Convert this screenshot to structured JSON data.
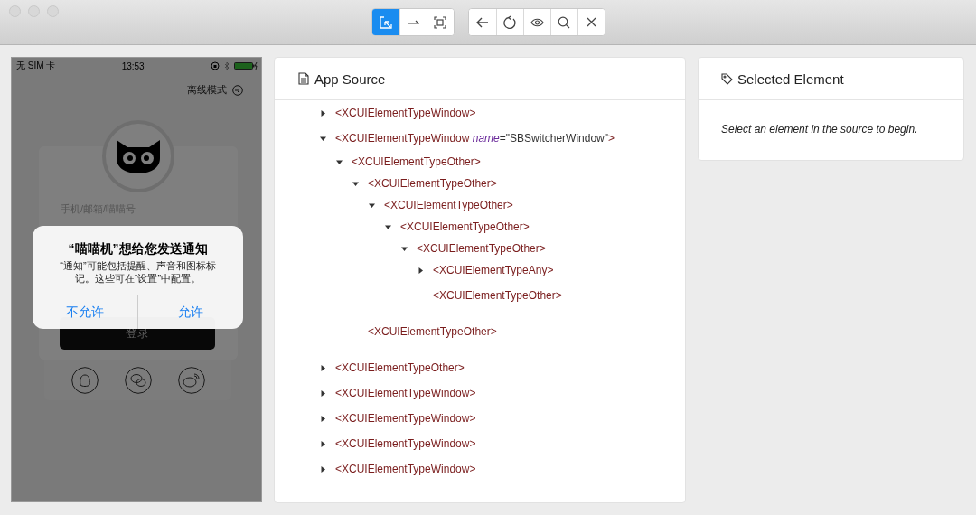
{
  "toolbar": {
    "groups": [
      {
        "buttons": [
          {
            "kind": "select",
            "selected": true
          },
          {
            "kind": "swipe",
            "selected": false
          },
          {
            "kind": "tap-area",
            "selected": false
          }
        ]
      },
      {
        "buttons": [
          {
            "kind": "back",
            "selected": false
          },
          {
            "kind": "refresh",
            "selected": false
          },
          {
            "kind": "eye",
            "selected": false
          },
          {
            "kind": "search",
            "selected": false
          },
          {
            "kind": "close",
            "selected": false
          }
        ]
      }
    ]
  },
  "phone": {
    "status_bar": {
      "carrier": "无 SIM 卡",
      "time": "13:53"
    },
    "offline_link": "离线模式",
    "login_field": {
      "placeholder": "手机/邮箱/喵喵号"
    },
    "login_button": "登录",
    "alert": {
      "title": "“喵喵机”想给您发送通知",
      "message": "“通知”可能包括提醒、声音和图标标记。这些可在“设置”中配置。",
      "buttons": [
        "不允许",
        "允许"
      ]
    }
  },
  "source": {
    "title": "App Source",
    "tree": [
      {
        "tag": "<XCUIElementTypeWindow>",
        "expanded": false
      },
      {
        "tag": "<XCUIElementTypeWindow",
        "attr_name": "name",
        "attr_eq": "=",
        "attr_value": "\"SBSwitcherWindow\"",
        "close": ">",
        "expanded": true,
        "children": [
          {
            "tag": "<XCUIElementTypeOther>",
            "expanded": true,
            "children": [
              {
                "tag": "<XCUIElementTypeOther>",
                "expanded": true,
                "children": [
                  {
                    "tag": "<XCUIElementTypeOther>",
                    "expanded": true,
                    "children": [
                      {
                        "tag": "<XCUIElementTypeOther>",
                        "expanded": true,
                        "children": [
                          {
                            "tag": "<XCUIElementTypeOther>",
                            "expanded": true,
                            "children": [
                              {
                                "tag": "<XCUIElementTypeAny>",
                                "expanded": false
                              },
                              {
                                "tag": "<XCUIElementTypeOther>"
                              }
                            ]
                          }
                        ]
                      }
                    ]
                  }
                ]
              },
              {
                "tag": "<XCUIElementTypeOther>"
              }
            ]
          }
        ]
      },
      {
        "tag": "<XCUIElementTypeOther>",
        "expanded": false
      },
      {
        "tag": "<XCUIElementTypeWindow>",
        "expanded": false
      },
      {
        "tag": "<XCUIElementTypeWindow>",
        "expanded": false
      },
      {
        "tag": "<XCUIElementTypeWindow>",
        "expanded": false
      },
      {
        "tag": "<XCUIElementTypeWindow>",
        "expanded": false
      }
    ]
  },
  "selected_element": {
    "title": "Selected Element",
    "message": "Select an element in the source to begin."
  }
}
